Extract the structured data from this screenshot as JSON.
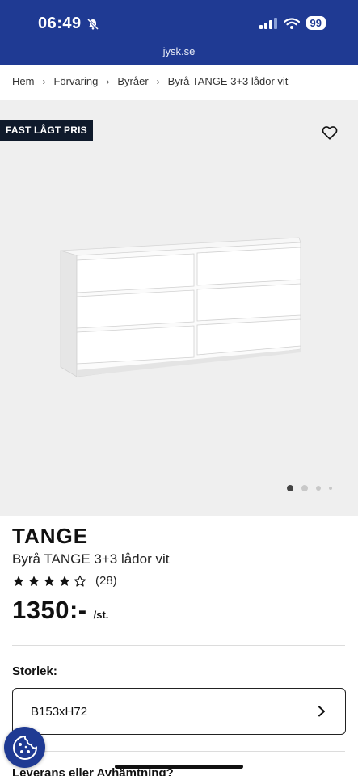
{
  "status_bar": {
    "time": "06:49",
    "battery": "99",
    "url": "jysk.se"
  },
  "breadcrumb": [
    "Hem",
    "Förvaring",
    "Byråer",
    "Byrå TANGE 3+3 lådor vit"
  ],
  "badge": "FAST LÅGT PRIS",
  "carousel": {
    "total_images": 4,
    "active_index": 0
  },
  "product": {
    "title": "TANGE",
    "subtitle": "Byrå TANGE 3+3 lådor vit",
    "rating": 4,
    "reviews": "(28)",
    "price": "1350:-",
    "price_unit": "/st."
  },
  "size": {
    "label": "Storlek:",
    "value": "B153xH72"
  },
  "delivery_label": "Leverans eller Avhämtning?",
  "colors": {
    "brand_blue": "#1f3a93",
    "badge_bg": "#0f1a2b",
    "image_bg": "#efefef"
  },
  "icons": {
    "silent": "bell-slash-icon",
    "favorite": "heart-icon",
    "chevron": "chevron-right-icon",
    "cookie": "cookie-icon",
    "rating": "star-icon"
  }
}
